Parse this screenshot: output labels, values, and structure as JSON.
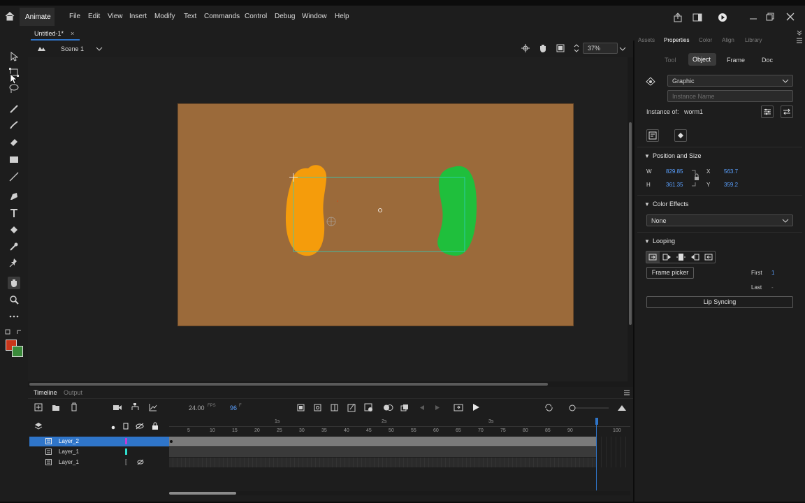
{
  "app": {
    "name": "Animate",
    "menu": [
      "File",
      "Edit",
      "View",
      "Insert",
      "Modify",
      "Text",
      "Commands",
      "Control",
      "Debug",
      "Window",
      "Help"
    ]
  },
  "document": {
    "tab_title": "Untitled-1*",
    "close_glyph": "×"
  },
  "scene": {
    "name": "Scene 1",
    "zoom": "37%"
  },
  "timeline": {
    "tabs": [
      "Timeline",
      "Output"
    ],
    "fps": "24.00",
    "fps_unit": "FPS",
    "frame": "96",
    "frame_unit": "F",
    "seconds": [
      "1s",
      "2s",
      "3s"
    ],
    "frame_ticks": [
      "5",
      "10",
      "15",
      "20",
      "25",
      "30",
      "35",
      "40",
      "45",
      "50",
      "55",
      "60",
      "65",
      "70",
      "75",
      "80",
      "85",
      "90",
      "100"
    ],
    "layers": [
      "Layer_2",
      "Layer_1",
      "Layer_1"
    ],
    "layer_colors": [
      "#c23bd6",
      "#2fe0d0",
      "#222222"
    ]
  },
  "panel": {
    "tabs": [
      "Assets",
      "Properties",
      "Color",
      "Align",
      "Library"
    ],
    "subtabs": [
      "Tool",
      "Object",
      "Frame",
      "Doc"
    ],
    "symbol_type": "Graphic",
    "instance_name_placeholder": "Instance Name",
    "instance_of_label": "Instance of:",
    "instance_of_value": "worm1",
    "position_size": {
      "title": "Position and Size",
      "w_label": "W",
      "w_value": "829.85",
      "h_label": "H",
      "h_value": "361.35",
      "x_label": "X",
      "x_value": "563.7",
      "y_label": "Y",
      "y_value": "359.2"
    },
    "color_effects": {
      "title": "Color Effects",
      "value": "None"
    },
    "looping": {
      "title": "Looping",
      "frame_picker": "Frame picker",
      "first_label": "First",
      "first_value": "1",
      "last_label": "Last",
      "last_value": "-",
      "lip_syncing": "Lip Syncing"
    }
  },
  "colors": {
    "stage": "#9b6a3a",
    "orange_shape": "#f59c0b",
    "green_shape": "#1fbf3c",
    "accent_blue": "#2f75c9",
    "stroke_color": "#c8361a",
    "fill_color": "#3a8a3a"
  }
}
